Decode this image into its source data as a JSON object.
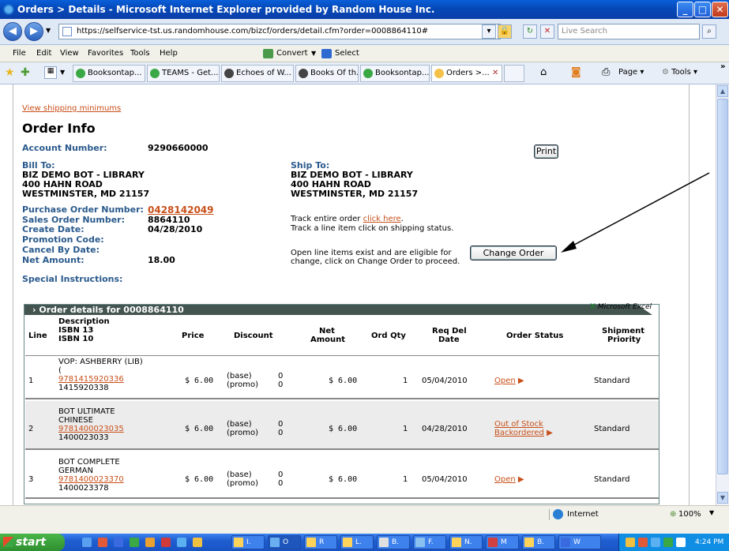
{
  "window": {
    "title": "Orders > Details - Microsoft Internet Explorer provided by Random House Inc.",
    "min": "_",
    "max": "□",
    "close": "✕"
  },
  "address": {
    "url": "https://selfservice-tst.us.randomhouse.com/bizcf/orders/detail.cfm?order=0008864110#",
    "search_placeholder": "Live Search"
  },
  "menu": [
    "File",
    "Edit",
    "View",
    "Favorites",
    "Tools",
    "Help"
  ],
  "toolbar": {
    "convert": "Convert",
    "select": "Select"
  },
  "tabs": [
    "Booksontap...",
    "TEAMS - Get...",
    "Echoes of W...",
    "Books Of th...",
    "Booksontap...",
    "Orders >..."
  ],
  "cmdbar": {
    "page": "Page",
    "tools": "Tools"
  },
  "order": {
    "shipping_link": "View shipping minimums",
    "heading": "Order Info",
    "account_label": "Account Number:",
    "account_value": "9290660000",
    "print_label": "Print",
    "bill_to_label": "Bill To:",
    "bill_to": [
      "BIZ DEMO BOT - LIBRARY",
      "400 HAHN ROAD",
      "WESTMINSTER, MD 21157"
    ],
    "ship_to_label": "Ship To:",
    "ship_to": [
      "BIZ DEMO BOT - LIBRARY",
      "400 HAHN ROAD",
      "WESTMINSTER, MD 21157"
    ],
    "po_label": "Purchase Order Number:",
    "po_value": "0428142049",
    "sales_label": "Sales Order Number:",
    "sales_value": "8864110",
    "create_label": "Create Date:",
    "create_value": "04/28/2010",
    "promo_label": "Promotion Code:",
    "cancel_label": "Cancel By Date:",
    "net_label": "Net Amount:",
    "net_value": "18.00",
    "special_label": "Special Instructions:",
    "track_prefix": "Track entire order ",
    "track_link": "click here",
    "track_suffix": ".",
    "track_line": "Track a line item click on shipping status.",
    "open_line1": "Open line items exist and are eligible for",
    "open_line2": "change, click on Change Order to proceed.",
    "change_label": "Change Order"
  },
  "details": {
    "header": "Order details for 0008864110",
    "excel": "Microsoft Excel",
    "columns": {
      "line": "Line",
      "desc1": "Description",
      "desc2": "ISBN 13",
      "desc3": "ISBN 10",
      "price": "Price",
      "discount": "Discount",
      "net1": "Net",
      "net2": "Amount",
      "qty": "Ord Qty",
      "req1": "Req Del",
      "req2": "Date",
      "status": "Order Status",
      "ship1": "Shipment",
      "ship2": "Priority"
    },
    "rows": [
      {
        "line": "1",
        "desc1": "VOP: ASHBERRY (LIB)",
        "desc2": "(",
        "isbn13": "9781415920336",
        "isbn10": "1415920338",
        "price": "$ 6.00",
        "disc1": "(base)",
        "disc2": "(promo)",
        "d1": "0",
        "d2": "0",
        "net": "$ 6.00",
        "qty": "1",
        "req": "05/04/2010",
        "status1": "Open",
        "status2": "",
        "ship": "Standard"
      },
      {
        "line": "2",
        "desc1": "BOT ULTIMATE",
        "desc2": "CHINESE",
        "isbn13": "9781400023035",
        "isbn10": "1400023033",
        "price": "$ 6.00",
        "disc1": "(base)",
        "disc2": "(promo)",
        "d1": "0",
        "d2": "0",
        "net": "$ 6.00",
        "qty": "1",
        "req": "04/28/2010",
        "status1": "Out of Stock",
        "status2": "Backordered",
        "ship": "Standard"
      },
      {
        "line": "3",
        "desc1": "BOT COMPLETE",
        "desc2": "GERMAN",
        "isbn13": "9781400023370",
        "isbn10": "1400023378",
        "price": "$ 6.00",
        "disc1": "(base)",
        "disc2": "(promo)",
        "d1": "0",
        "d2": "0",
        "net": "$ 6.00",
        "qty": "1",
        "req": "05/04/2010",
        "status1": "Open",
        "status2": "",
        "ship": "Standard"
      }
    ]
  },
  "status": {
    "zone": "Internet",
    "zoom": "100%"
  },
  "taskbar": {
    "start": "start",
    "items": [
      "I.",
      "O",
      "R",
      "L.",
      "B.",
      "F.",
      "N.",
      "M",
      "B.",
      "W"
    ],
    "time": "4:24 PM"
  }
}
